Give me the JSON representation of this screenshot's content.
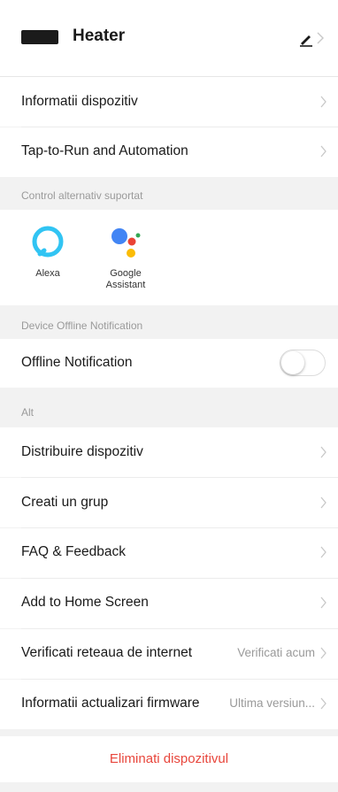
{
  "header": {
    "title": "Heater"
  },
  "rows_top": [
    {
      "label": "Informatii dispozitiv"
    },
    {
      "label": "Tap-to-Run and Automation"
    }
  ],
  "section_control": {
    "title": "Control alternativ suportat"
  },
  "assistants": [
    {
      "name": "Alexa",
      "icon": "alexa-icon"
    },
    {
      "name": "Google Assistant",
      "icon": "google-assistant-icon"
    }
  ],
  "section_offline": {
    "title": "Device Offline Notification"
  },
  "offline_row": {
    "label": "Offline Notification",
    "enabled": false
  },
  "section_other": {
    "title": "Alt"
  },
  "rows_other": [
    {
      "label": "Distribuire dispozitiv"
    },
    {
      "label": "Creati un grup"
    },
    {
      "label": "FAQ & Feedback"
    },
    {
      "label": "Add to Home Screen"
    },
    {
      "label": "Verificati reteaua de internet",
      "value": "Verificati acum"
    },
    {
      "label": "Informatii actualizari firmware",
      "value": "Ultima versiun..."
    }
  ],
  "delete": {
    "label": "Eliminati dispozitivul",
    "color": "#e8463c"
  },
  "colors": {
    "alexa": "#31c4f3",
    "google_blue": "#4285f4",
    "google_red": "#ea4335",
    "google_yellow": "#fbbc05",
    "google_green": "#34a853"
  }
}
